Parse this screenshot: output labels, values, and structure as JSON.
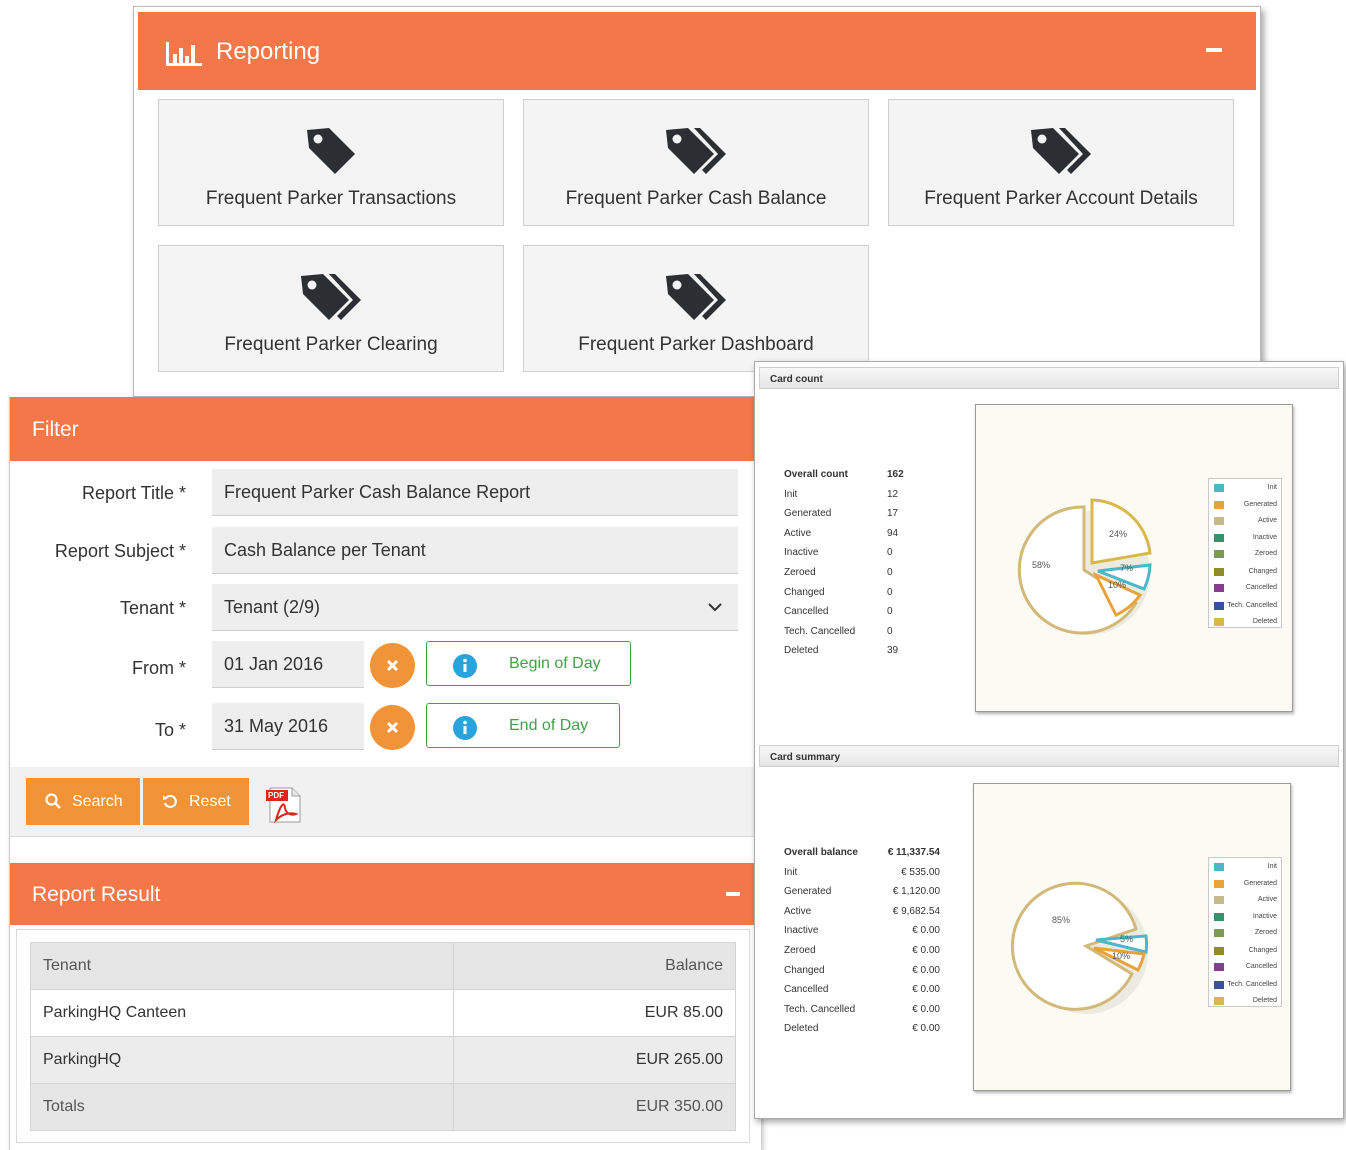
{
  "reporting": {
    "title": "Reporting",
    "tiles": [
      {
        "label": "Frequent Parker Transactions"
      },
      {
        "label": "Frequent Parker Cash Balance"
      },
      {
        "label": "Frequent Parker Account Details"
      },
      {
        "label": "Frequent Parker Clearing"
      },
      {
        "label": "Frequent Parker Dashboard"
      }
    ]
  },
  "filter": {
    "title": "Filter",
    "report_title_label": "Report Title *",
    "report_title_value": "Frequent Parker Cash Balance Report",
    "report_subject_label": "Report Subject *",
    "report_subject_value": "Cash Balance per Tenant",
    "tenant_label": "Tenant *",
    "tenant_value": "Tenant (2/9)",
    "from_label": "From *",
    "from_value": "01 Jan 2016",
    "from_option": "Begin of Day",
    "to_label": "To *",
    "to_value": "31 May 2016",
    "to_option": "End of Day",
    "search_label": "Search",
    "reset_label": "Reset",
    "pdf_text": "PDF"
  },
  "result": {
    "title": "Report Result",
    "columns": [
      "Tenant",
      "Balance"
    ],
    "rows": [
      {
        "tenant": "ParkingHQ Canteen",
        "balance": "EUR 85.00"
      },
      {
        "tenant": "ParkingHQ",
        "balance": "EUR 265.00"
      }
    ],
    "totals": {
      "label": "Totals",
      "value": "EUR 350.00"
    }
  },
  "card_count": {
    "title": "Card count",
    "items": [
      {
        "label": "Overall count",
        "value": "162"
      },
      {
        "label": "Init",
        "value": "12"
      },
      {
        "label": "Generated",
        "value": "17"
      },
      {
        "label": "Active",
        "value": "94"
      },
      {
        "label": "Inactive",
        "value": "0"
      },
      {
        "label": "Zeroed",
        "value": "0"
      },
      {
        "label": "Changed",
        "value": "0"
      },
      {
        "label": "Cancelled",
        "value": "0"
      },
      {
        "label": "Tech. Cancelled",
        "value": "0"
      },
      {
        "label": "Deleted",
        "value": "39"
      }
    ],
    "pie_labels": [
      "58%",
      "24%",
      "7%",
      "10%"
    ]
  },
  "card_summary": {
    "title": "Card summary",
    "items": [
      {
        "label": "Overall balance",
        "value": "€ 11,337.54"
      },
      {
        "label": "Init",
        "value": "€ 535.00"
      },
      {
        "label": "Generated",
        "value": "€ 1,120.00"
      },
      {
        "label": "Active",
        "value": "€ 9,682.54"
      },
      {
        "label": "Inactive",
        "value": "€ 0.00"
      },
      {
        "label": "Zeroed",
        "value": "€ 0.00"
      },
      {
        "label": "Changed",
        "value": "€ 0.00"
      },
      {
        "label": "Cancelled",
        "value": "€ 0.00"
      },
      {
        "label": "Tech. Cancelled",
        "value": "€ 0.00"
      },
      {
        "label": "Deleted",
        "value": "€ 0.00"
      }
    ],
    "pie_labels": [
      "85%",
      "5%",
      "10%"
    ]
  },
  "legend": [
    {
      "label": "Init",
      "color": "#4bb8c8"
    },
    {
      "label": "Generated",
      "color": "#e8a23a"
    },
    {
      "label": "Active",
      "color": "#c8b98a"
    },
    {
      "label": "Inactive",
      "color": "#3c8f6b"
    },
    {
      "label": "Zeroed",
      "color": "#7a9a55"
    },
    {
      "label": "Changed",
      "color": "#8f8a2a"
    },
    {
      "label": "Cancelled",
      "color": "#8a3a8f"
    },
    {
      "label": "Tech. Cancelled",
      "color": "#3a4fa0"
    },
    {
      "label": "Deleted",
      "color": "#d9b84a"
    }
  ],
  "colors": {
    "accent": "#f4774a",
    "button": "#f19437",
    "success": "#43a047",
    "info": "#29a3dc"
  }
}
